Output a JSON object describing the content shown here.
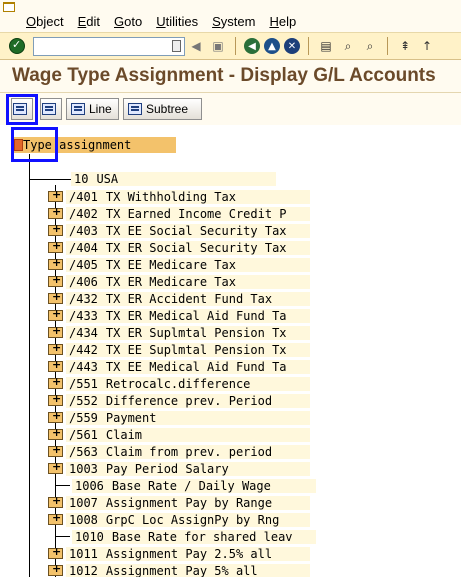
{
  "menu": {
    "items": [
      {
        "underline": "O",
        "rest": "bject"
      },
      {
        "underline": "E",
        "rest": "dit"
      },
      {
        "underline": "G",
        "rest": "oto"
      },
      {
        "underline": "U",
        "rest": "tilities"
      },
      {
        "underline": "S",
        "rest": "ystem"
      },
      {
        "underline": "H",
        "rest": "elp"
      }
    ]
  },
  "toolbar": {
    "command_value": "",
    "icons": [
      "enter-icon",
      "command-history-icon",
      "navigate-left-icon",
      "save-icon",
      "back-icon",
      "exit-icon",
      "cancel-icon",
      "print-icon",
      "find-icon",
      "find-next-icon",
      "first-page-icon",
      "previous-page-icon"
    ]
  },
  "title": "Wage Type Assignment - Display G/L Accounts",
  "app_toolbar": {
    "line_label": "Line",
    "subtree_label": "Subtree"
  },
  "tree": {
    "root_label": "Type assignment",
    "country_code": "10",
    "country_name": "USA",
    "rows": [
      {
        "code": "/401",
        "text": "TX Withholding Tax",
        "expandable": true
      },
      {
        "code": "/402",
        "text": "TX Earned Income Credit P",
        "expandable": true
      },
      {
        "code": "/403",
        "text": "TX EE Social Security Tax",
        "expandable": true
      },
      {
        "code": "/404",
        "text": "TX ER Social Security Tax",
        "expandable": true
      },
      {
        "code": "/405",
        "text": "TX EE Medicare Tax",
        "expandable": true
      },
      {
        "code": "/406",
        "text": "TX ER Medicare Tax",
        "expandable": true
      },
      {
        "code": "/432",
        "text": "TX ER Accident Fund Tax",
        "expandable": true
      },
      {
        "code": "/433",
        "text": "TX ER Medical Aid Fund Ta",
        "expandable": true
      },
      {
        "code": "/434",
        "text": "TX ER Suplmtal Pension Tx",
        "expandable": true
      },
      {
        "code": "/442",
        "text": "TX EE Suplmtal Pension Tx",
        "expandable": true
      },
      {
        "code": "/443",
        "text": "TX EE Medical Aid Fund Ta",
        "expandable": true
      },
      {
        "code": "/551",
        "text": "Retrocalc.difference",
        "expandable": true
      },
      {
        "code": "/552",
        "text": "Difference prev. Period",
        "expandable": true
      },
      {
        "code": "/559",
        "text": "Payment",
        "expandable": true
      },
      {
        "code": "/561",
        "text": "Claim",
        "expandable": true
      },
      {
        "code": "/563",
        "text": "Claim from prev. period",
        "expandable": true
      },
      {
        "code": "1003",
        "text": "Pay Period Salary",
        "expandable": true
      },
      {
        "code": "1006",
        "text": "Base Rate / Daily Wage",
        "expandable": false
      },
      {
        "code": "1007",
        "text": "Assignment Pay by Range",
        "expandable": true
      },
      {
        "code": "1008",
        "text": "GrpC Loc AssignPy by Rng",
        "expandable": true
      },
      {
        "code": "1010",
        "text": "Base Rate for shared leav",
        "expandable": false
      },
      {
        "code": "1011",
        "text": "Assignment Pay 2.5% all",
        "expandable": true
      },
      {
        "code": "1012",
        "text": "Assignment Pay 5% all",
        "expandable": true
      }
    ]
  }
}
